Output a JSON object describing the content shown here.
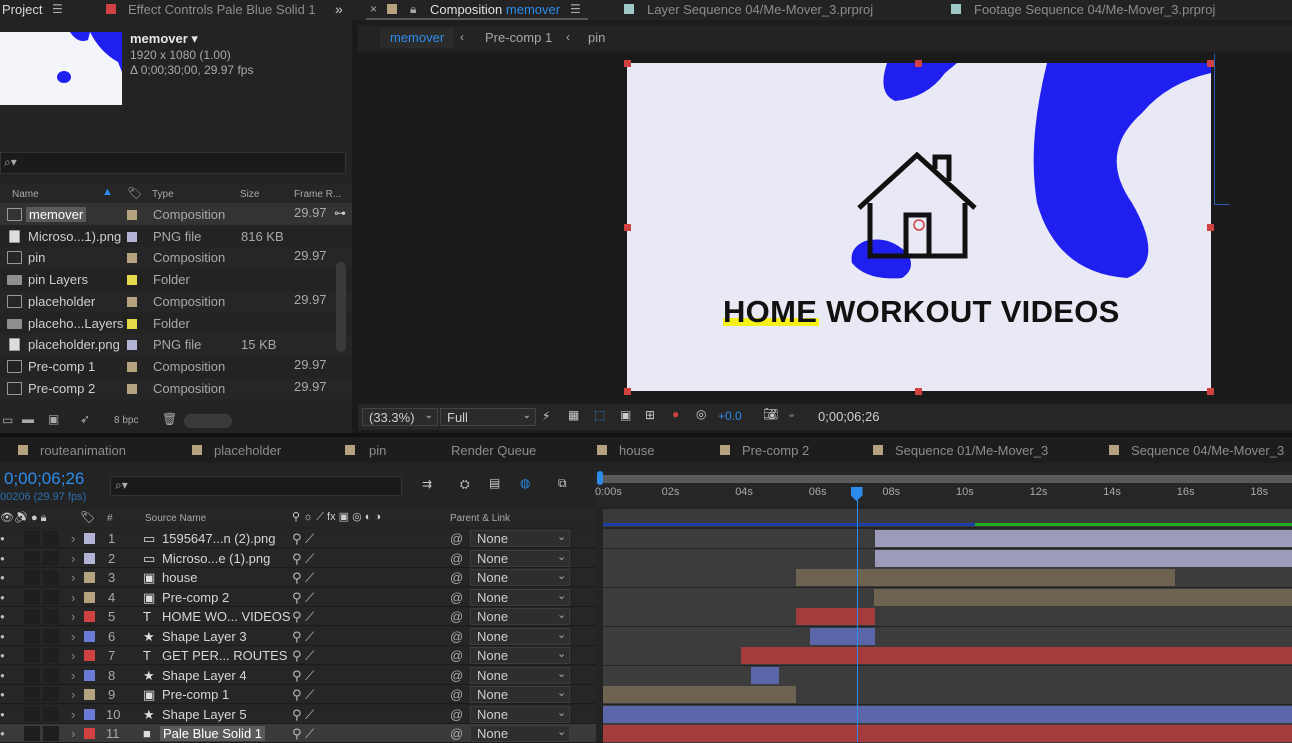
{
  "top_tabs": {
    "project": "Project",
    "effect_controls": "Effect Controls Pale Blue Solid 1",
    "composition_prefix": "Composition",
    "composition_name": "memover",
    "layer": "Layer  Sequence 04/Me-Mover_3.prproj",
    "footage": "Footage  Sequence 04/Me-Mover_3.prproj"
  },
  "breadcrumbs": [
    "memover",
    "Pre-comp 1",
    "pin"
  ],
  "project_info": {
    "name": "memover",
    "resolution": "1920 x 1080 (1.00)",
    "duration": "Δ 0;00;30;00, 29.97 fps"
  },
  "project_columns": {
    "name": "Name",
    "type": "Type",
    "size": "Size",
    "frame_rate": "Frame R..."
  },
  "project_items": [
    {
      "name": "memover",
      "type": "Composition",
      "size": "",
      "fps": "29.97",
      "color": "#b5a27e",
      "icon": "comp-icon",
      "selected": true
    },
    {
      "name": "Microso...1).png",
      "type": "PNG file",
      "size": "816 KB",
      "fps": "",
      "color": "#b3b3d6",
      "icon": "png-icon"
    },
    {
      "name": "pin",
      "type": "Composition",
      "size": "",
      "fps": "29.97",
      "color": "#b5a27e",
      "icon": "comp-icon"
    },
    {
      "name": "pin Layers",
      "type": "Folder",
      "size": "",
      "fps": "",
      "color": "#e6d84a",
      "icon": "folder-icon"
    },
    {
      "name": "placeholder",
      "type": "Composition",
      "size": "",
      "fps": "29.97",
      "color": "#b5a27e",
      "icon": "comp-icon"
    },
    {
      "name": "placeho...Layers",
      "type": "Folder",
      "size": "",
      "fps": "",
      "color": "#e6d84a",
      "icon": "folder-icon"
    },
    {
      "name": "placeholder.png",
      "type": "PNG file",
      "size": "15 KB",
      "fps": "",
      "color": "#b3b3d6",
      "icon": "png-icon"
    },
    {
      "name": "Pre-comp 1",
      "type": "Composition",
      "size": "",
      "fps": "29.97",
      "color": "#b5a27e",
      "icon": "comp-icon"
    },
    {
      "name": "Pre-comp 2",
      "type": "Composition",
      "size": "",
      "fps": "29.97",
      "color": "#b5a27e",
      "icon": "comp-icon"
    }
  ],
  "project_footer": {
    "bpc": "8 bpc"
  },
  "comp": {
    "headline": "HOME WORKOUT VIDEOS",
    "zoom": "(33.3%)",
    "resolution": "Full",
    "exposure": "+0.0",
    "timecode": "0;00;06;26"
  },
  "timeline_tabs": [
    "routeanimation",
    "placeholder",
    "pin",
    "Render Queue",
    "house",
    "Pre-comp 2",
    "Sequence 01/Me-Mover_3",
    "Sequence 04/Me-Mover_3"
  ],
  "timeline": {
    "timecode": "0;00;06;26",
    "frame_info": "00206 (29.97 fps)",
    "col_hash": "#",
    "col_source": "Source Name",
    "col_parent": "Parent & Link",
    "ruler": [
      "0:00s",
      "02s",
      "04s",
      "06s",
      "08s",
      "10s",
      "12s",
      "14s",
      "16s",
      "18s"
    ]
  },
  "layers": [
    {
      "num": "1",
      "name": "1595647...n (2).png",
      "color": "#b3b3d6",
      "icon": "png-icon",
      "parent": "None",
      "bar": [
        0.395,
        1.0
      ],
      "bar_color": "#9c9cba"
    },
    {
      "num": "2",
      "name": "Microso...e (1).png",
      "color": "#b3b3d6",
      "icon": "png-icon",
      "parent": "None",
      "bar": [
        0.395,
        1.0
      ],
      "bar_color": "#9c9cba"
    },
    {
      "num": "3",
      "name": "house",
      "color": "#b5a27e",
      "icon": "comp-icon",
      "parent": "None",
      "bar": [
        0.28,
        0.83
      ],
      "bar_color": "#6e6350"
    },
    {
      "num": "4",
      "name": "Pre-comp 2",
      "color": "#b5a27e",
      "icon": "comp-icon",
      "parent": "None",
      "bar": [
        0.393,
        1.0
      ],
      "bar_color": "#6e6350"
    },
    {
      "num": "5",
      "name": "HOME WO... VIDEOS",
      "color": "#d04242",
      "icon": "text-icon",
      "parent": "None",
      "bar": [
        0.28,
        0.395
      ],
      "bar_color": "#a33d3d"
    },
    {
      "num": "6",
      "name": "Shape Layer 3",
      "color": "#6a7bd6",
      "icon": "star-icon",
      "parent": "None",
      "bar": [
        0.3,
        0.395
      ],
      "bar_color": "#5a66a8"
    },
    {
      "num": "7",
      "name": "GET PER... ROUTES",
      "color": "#d04242",
      "icon": "text-icon",
      "parent": "None",
      "bar": [
        0.2,
        1.0
      ],
      "bar_color": "#a33d3d"
    },
    {
      "num": "8",
      "name": "Shape Layer 4",
      "color": "#6a7bd6",
      "icon": "star-icon",
      "parent": "None",
      "bar": [
        0.215,
        0.255
      ],
      "bar_color": "#5a66a8"
    },
    {
      "num": "9",
      "name": "Pre-comp 1",
      "color": "#b5a27e",
      "icon": "comp-icon",
      "parent": "None",
      "bar": [
        0.0,
        0.28
      ],
      "bar_color": "#6e6350"
    },
    {
      "num": "10",
      "name": "Shape Layer 5",
      "color": "#6a7bd6",
      "icon": "star-icon",
      "parent": "None",
      "bar": [
        0.0,
        1.0
      ],
      "bar_color": "#5a66a8"
    },
    {
      "num": "11",
      "name": "Pale Blue Solid 1",
      "color": "#d04242",
      "icon": "solid-icon",
      "parent": "None",
      "bar": [
        0.0,
        1.0
      ],
      "bar_color": "#a33d3d",
      "selected": true
    }
  ],
  "colors": {
    "accent": "#2d8ceb",
    "comp_bg": "#e8e9f4",
    "blob": "#1f1ff0"
  },
  "playhead_fraction": 0.368
}
